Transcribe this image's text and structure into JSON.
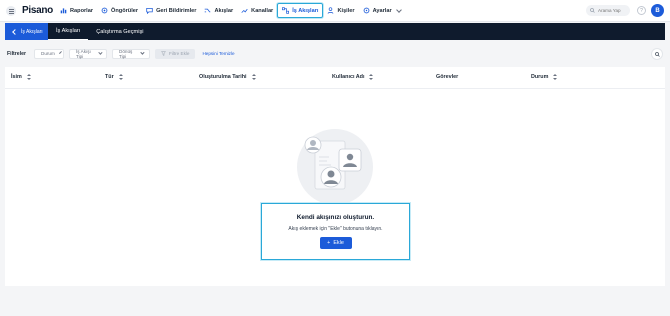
{
  "app": {
    "logo_text": "Pisano"
  },
  "nav": {
    "items": [
      {
        "label": "Raporlar",
        "icon": "chart-icon"
      },
      {
        "label": "Öngörüler",
        "icon": "insight-icon"
      },
      {
        "label": "Geri Bildirimler",
        "icon": "feedback-icon"
      },
      {
        "label": "Akışlar",
        "icon": "flow-icon"
      },
      {
        "label": "Kanallar",
        "icon": "channel-icon"
      },
      {
        "label": "İş Akışları",
        "icon": "workflow-icon",
        "active": true
      },
      {
        "label": "Kişiler",
        "icon": "person-icon"
      },
      {
        "label": "Ayarlar",
        "icon": "gear-icon"
      }
    ],
    "search_placeholder": "Arama Yap",
    "help_label": "?",
    "avatar_initial": "B"
  },
  "tabbar": {
    "back_label": "İş Akışları",
    "tabs": [
      {
        "label": "İş Akışları",
        "active": true
      },
      {
        "label": "Çalıştırma Geçmişi",
        "active": false
      }
    ]
  },
  "filters": {
    "label": "Filtreler",
    "selects": [
      "Durum",
      "İş Akışı Tipi",
      "Dönüş Tipi"
    ],
    "add_filter": "Filtre Ekle",
    "clear_all": "Hepsini Temizle"
  },
  "table": {
    "columns": [
      "İsim",
      "Tür",
      "Oluşturulma Tarihi",
      "Kullanıcı Adı",
      "Görevler",
      "Durum"
    ]
  },
  "empty_state": {
    "title": "Kendi akışınızı oluşturun.",
    "description": "Akış eklemek için \"Ekle\" butonuna tıklayın.",
    "button_label": "Ekle"
  },
  "colors": {
    "primary": "#1c5bd9",
    "dark": "#0f1b2d",
    "highlight": "#2aa8d8"
  }
}
